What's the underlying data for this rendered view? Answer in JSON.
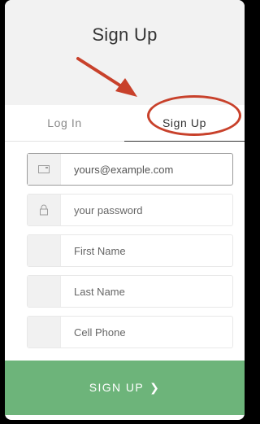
{
  "header": {
    "title": "Sign Up"
  },
  "tabs": [
    {
      "label": "Log In",
      "active": false
    },
    {
      "label": "Sign Up",
      "active": true
    }
  ],
  "form": {
    "email": {
      "value": "yours@example.com",
      "icon": "envelope-icon"
    },
    "password": {
      "placeholder": "your password",
      "icon": "lock-icon"
    },
    "first_name": {
      "placeholder": "First Name"
    },
    "last_name": {
      "placeholder": "Last Name"
    },
    "cell_phone": {
      "placeholder": "Cell Phone"
    }
  },
  "submit": {
    "label": "SIGN UP",
    "chevron": "❯"
  },
  "colors": {
    "accent_green": "#6db47a",
    "annotation_red": "#c8412b",
    "header_bg": "#f2f2f2"
  }
}
